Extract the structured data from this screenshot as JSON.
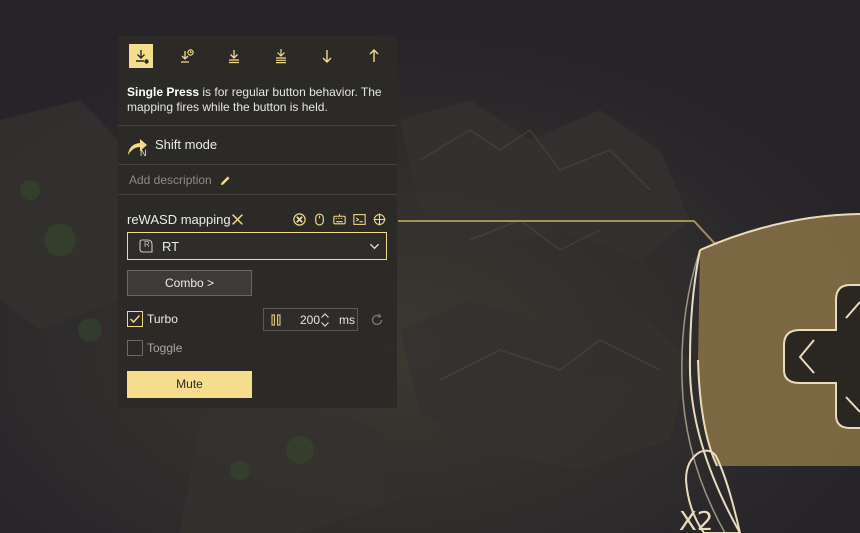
{
  "modes": [
    {
      "name": "single-press",
      "active": true
    },
    {
      "name": "long-press",
      "active": false
    },
    {
      "name": "double-press",
      "active": false
    },
    {
      "name": "triple-press",
      "active": false
    },
    {
      "name": "start-press",
      "active": false
    },
    {
      "name": "release",
      "active": false
    }
  ],
  "description": {
    "bold": "Single Press",
    "text": " is for regular button behavior. The mapping fires while the button is held."
  },
  "shift": {
    "label": "Shift mode",
    "badge": "N"
  },
  "add_description": "Add description",
  "mapping": {
    "label": "reWASD mapping",
    "tools": [
      "gamepad-icon",
      "mouse-icon",
      "keyboard-icon",
      "macro-icon",
      "crosshair-icon"
    ],
    "selected": "RT",
    "selected_icon": "R"
  },
  "combo_button": "Combo >",
  "turbo": {
    "label": "Turbo",
    "checked": true,
    "value": "200",
    "unit": "ms"
  },
  "toggle": {
    "label": "Toggle",
    "checked": false
  },
  "mute_button": "Mute",
  "device_label": "X2",
  "colors": {
    "accent": "#f6dc8d",
    "panel": "#2b2a27"
  }
}
